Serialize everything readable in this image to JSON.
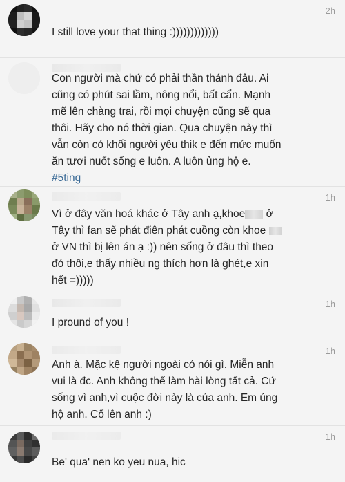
{
  "comments": [
    {
      "time": "2h",
      "lines": [
        "I still love your that thing :)))))))))))))"
      ]
    },
    {
      "time": "",
      "lines": [
        "Con người mà chứ có phải thần thánh đâu. Ai",
        "cũng có phút sai lầm, nông nổi, bất cẩn. Mạnh",
        "mẽ lên chàng trai, rồi mọi chuyện cũng sẽ qua",
        "thôi. Hãy cho nó thời gian. Qua chuyện này thì",
        "vẫn còn có khối người yêu thik e đến mức muốn",
        "ăn tươi nuốt sống e luôn. A luôn ủng hộ e."
      ],
      "hashtag": "#5ting"
    },
    {
      "time": "1h",
      "line1_a": "Vì ở đây văn hoá khác ở Tây anh ạ,khoe",
      "line1_b": "ở",
      "line2": "Tây thì fan sẽ phát điên phát cuồng còn khoe",
      "lines_rest": [
        "ở VN thì bị lên án ạ :)) nên sống ở đâu thì theo",
        "đó thôi,e thấy nhiều ng thích hơn là ghét,e xin",
        "hết =)))))"
      ]
    },
    {
      "time": "1h",
      "lines": [
        "I pround of you !"
      ]
    },
    {
      "time": "1h",
      "lines": [
        "Anh à. Mặc kệ người ngoài có nói gì. Miễn anh",
        "vui là đc. Anh không thể làm hài lòng tất cả. Cứ",
        "sống vì anh,vì cuộc đời này là của anh. Em ủng",
        "hộ anh. Cố lên anh :)"
      ]
    },
    {
      "time": "1h",
      "lines": [
        "Be' qua' nen ko yeu nua, hic"
      ]
    }
  ],
  "colors": {
    "background": "#f4f4f4",
    "text": "#262626",
    "time": "#9a9a9a",
    "hashtag": "#3a6a96"
  }
}
